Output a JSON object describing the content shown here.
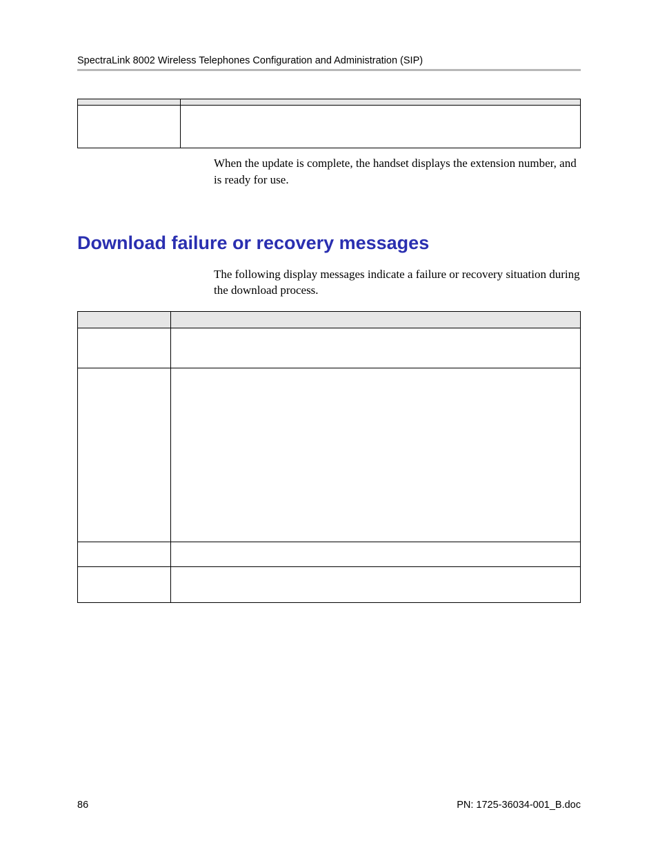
{
  "header": {
    "title": "SpectraLink 8002 Wireless Telephones Configuration and Administration (SIP)"
  },
  "table1": {
    "header_col1": "",
    "header_col2": "",
    "row1_col1": "",
    "row1_col2": ""
  },
  "para1": "When the update is complete, the handset displays the extension number, and is ready for use.",
  "section_heading": "Download failure or recovery messages",
  "para2": "The following display messages indicate a failure or recovery situation during the download process.",
  "table2": {
    "header_col1": "",
    "header_col2": "",
    "rows": [
      {
        "c1": "",
        "c2": ""
      },
      {
        "c1": "",
        "c2": ""
      },
      {
        "c1": "",
        "c2": ""
      },
      {
        "c1": "",
        "c2": ""
      }
    ]
  },
  "footer": {
    "page_number": "86",
    "doc_id": "PN: 1725-36034-001_B.doc"
  }
}
